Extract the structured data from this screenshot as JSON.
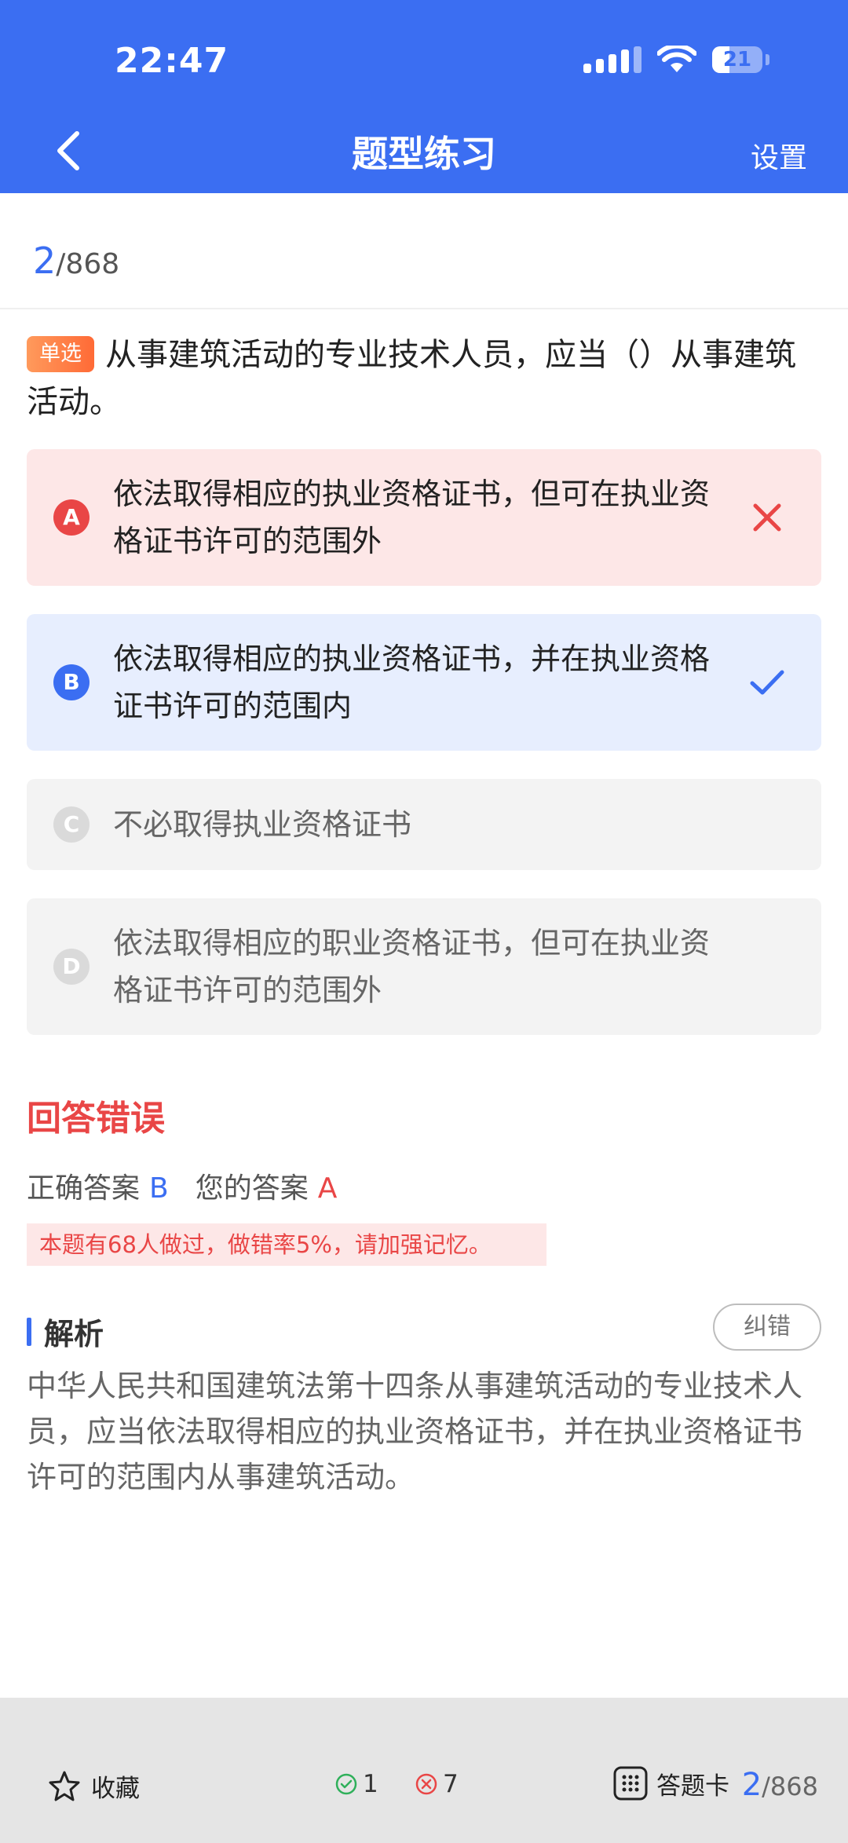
{
  "status": {
    "time": "22:47",
    "battery": "21"
  },
  "nav": {
    "title": "题型练习",
    "settings": "设置"
  },
  "progress": {
    "current": "2",
    "total": "/868"
  },
  "question": {
    "tag": "单选",
    "text": "从事建筑活动的专业技术人员，应当（）从事建筑活动。"
  },
  "options": [
    {
      "letter": "A",
      "text": "依法取得相应的执业资格证书，但可在执业资格证书许可的范围外",
      "state": "wrong"
    },
    {
      "letter": "B",
      "text": "依法取得相应的执业资格证书，并在执业资格证书许可的范围内",
      "state": "correct"
    },
    {
      "letter": "C",
      "text": "不必取得执业资格证书",
      "state": "neutral"
    },
    {
      "letter": "D",
      "text": "依法取得相应的职业资格证书，但可在执业资格证书许可的范围外",
      "state": "neutral"
    }
  ],
  "result": {
    "title": "回答错误",
    "correct_label": "正确答案",
    "correct_value": "B",
    "your_label": "您的答案",
    "your_value": "A",
    "note": "本题有68人做过，做错率5%，请加强记忆。"
  },
  "analysis": {
    "title": "解析",
    "report_button": "纠错",
    "text": "中华人民共和国建筑法第十四条从事建筑活动的专业技术人员，应当依法取得相应的执业资格证书，并在执业资格证书许可的范围内从事建筑活动。"
  },
  "bottom": {
    "favorite": "收藏",
    "right_count": "1",
    "wrong_count": "7",
    "answer_card": "答题卡",
    "current": "2",
    "total": "/868"
  },
  "colors": {
    "primary": "#3b6ef2",
    "error": "#e94646",
    "wrong_bg": "#fde7e7",
    "correct_bg": "#e7eefe"
  }
}
